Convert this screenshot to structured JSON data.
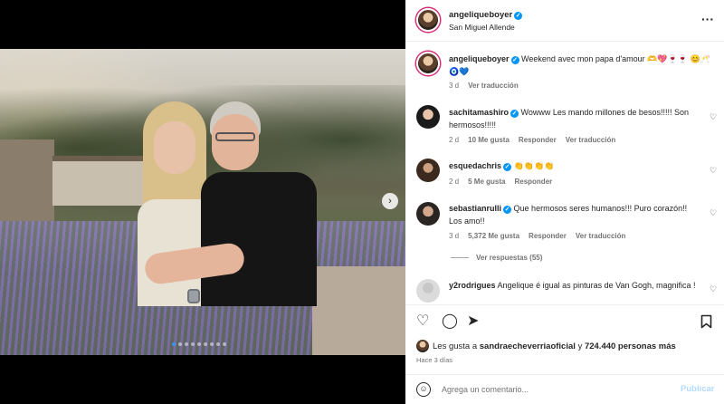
{
  "header": {
    "username": "angeliqueboyer",
    "location": "San Miguel Allende"
  },
  "caption": {
    "username": "angeliqueboyer",
    "text": "Weekend avec mon papa d'amour 🫶💖🍷🍷 😊🥂🧿💙",
    "time": "3 d",
    "translate": "Ver traducción"
  },
  "comments": [
    {
      "username": "sachitamashiro",
      "verified": true,
      "text": "Wowww Les mando millones de besos!!!!! Son hermosos!!!!!",
      "time": "2 d",
      "likes": "10 Me gusta",
      "reply": "Responder",
      "translate": "Ver traducción"
    },
    {
      "username": "esquedachris",
      "verified": true,
      "text": "👏👏👏👏",
      "time": "2 d",
      "likes": "5 Me gusta",
      "reply": "Responder"
    },
    {
      "username": "sebastianrulli",
      "verified": true,
      "text": "Que hermosos seres humanos!!! Puro corazón!! Los amo!!",
      "time": "3 d",
      "likes": "5,372 Me gusta",
      "reply": "Responder",
      "translate": "Ver traducción",
      "view_replies": "Ver respuestas (55)"
    },
    {
      "username": "y2rodrigues",
      "verified": false,
      "text": "Angelique é igual as pinturas de Van Gogh, magnifica !"
    }
  ],
  "likes": {
    "prefix": "Les gusta a",
    "user": "sandraecheverriaoficial",
    "conj": "y",
    "count": "724.440 personas más"
  },
  "time_ago": "Hace 3 días",
  "comment_box": {
    "placeholder": "Agrega un comentario...",
    "post_label": "Publicar"
  },
  "carousel": {
    "slide_count": 9,
    "active_index": 0
  },
  "colors": {
    "verified": "#0095f6",
    "muted": "#737373",
    "post_disabled": "#b3dbff",
    "active_dot": "#3897f0"
  },
  "icons": [
    "more-icon",
    "heart-icon",
    "comment-icon",
    "share-icon",
    "bookmark-icon",
    "emoji-icon",
    "next-icon",
    "verified-icon"
  ]
}
